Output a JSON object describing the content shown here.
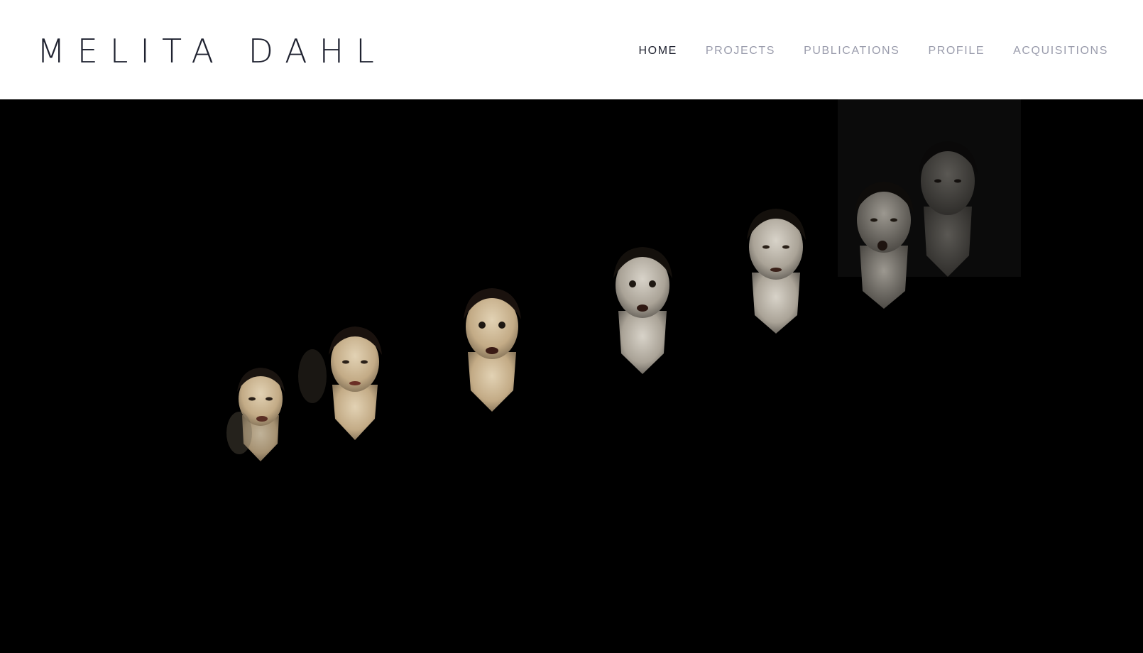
{
  "site": {
    "title": "MELITA DAHL"
  },
  "nav": {
    "items": [
      {
        "label": "HOME",
        "active": true
      },
      {
        "label": "PROJECTS",
        "active": false
      },
      {
        "label": "PUBLICATIONS",
        "active": false
      },
      {
        "label": "PROFILE",
        "active": false
      },
      {
        "label": "ACQUISITIONS",
        "active": false
      }
    ]
  },
  "hero": {
    "image": "photographic-artwork-sequence-of-faces",
    "background_color": "#000000"
  },
  "colors": {
    "nav_active": "#1f2230",
    "nav_inactive": "#9a9cac",
    "title": "#1f2230",
    "skin_warm": "#cdb896",
    "skin_neutral": "#bdb7ab"
  }
}
